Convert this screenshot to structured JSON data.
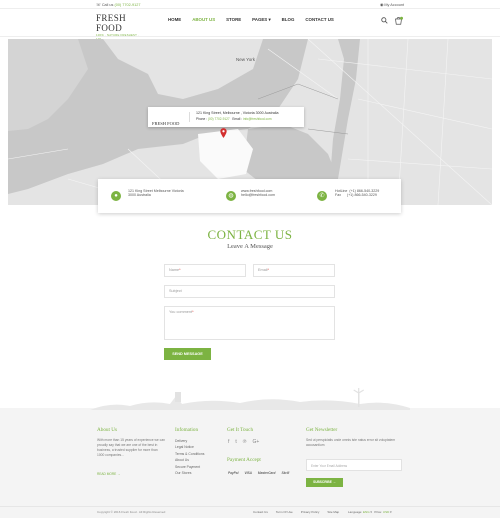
{
  "topbar": {
    "phone_label": "Call us",
    "phone": "(00) 7702-9127",
    "account": "My Account"
  },
  "logo": {
    "main": "FRESH FOOD",
    "sub": "100% · NATURE FRESHEST · 100"
  },
  "nav": [
    "HOME",
    "ABOUT US",
    "STORE",
    "PAGES",
    "BLOG",
    "CONTACT US"
  ],
  "nav_active": 1,
  "map": {
    "place_label": "New York"
  },
  "map_card": {
    "logo": "FRESH FOOD",
    "address": "121 King Street, Melbourne , Victoria 3000 Australia",
    "phone_label": "Phone :",
    "phone": "(00) 7702-9127",
    "email_label": "Email :",
    "email": "info@freshfood.com"
  },
  "info": {
    "address1": "121 King Street Melbourne Victoria",
    "address2": "3000 Australia",
    "web": "www.freshfood.com",
    "mail": "hello@freshfood.com",
    "hotline_label": "HotLine",
    "hotline": "(+1) 866-540-3229",
    "fax_label": "Fax",
    "fax": "(+1) 866-540-3229"
  },
  "contact": {
    "title": "CONTACT US",
    "subtitle": "Leave A Message",
    "name_ph": "Name",
    "email_ph": "Email",
    "subject_ph": "Subject",
    "comment_ph": "You comment",
    "send": "SEND MESSAGE"
  },
  "footer": {
    "about_title": "About Us",
    "about_text": "With more than 15 years of experience we can proudly say that we are one of the best in business, a trusted supplier for more than 1000 companies...",
    "read_more": "READ MORE",
    "info_title": "Infomation",
    "info_links": [
      "Delivery",
      "Legal Notice",
      "Terms & Conditions",
      "About Us",
      "Secure Payment",
      "Our Stores"
    ],
    "touch_title": "Get It Touch",
    "payment_title": "Payment Accept",
    "payments": [
      "PayPal",
      "VISA",
      "MasterCard",
      "Skrill"
    ],
    "news_title": "Get Newsletter",
    "news_text": "Sed ut perspiciatis unde omnis iste natus error sit voluptatem accusantium",
    "news_ph": "Enter Your Email Address",
    "subscribe": "SUBSCRIBE"
  },
  "bottom": {
    "copyright": "Copyright © 2016 Fresh Food . All Rights Reserved",
    "links": [
      "Contact Us",
      "Term Of Use",
      "Privacy Policy",
      "Site Map"
    ],
    "lang_label": "Language:",
    "lang": "ENG",
    "price_label": "Price:",
    "currency": "USD"
  },
  "colors": {
    "accent": "#7cb342",
    "footer_bg": "#f4f4f4",
    "map_bg": "#dedede"
  }
}
